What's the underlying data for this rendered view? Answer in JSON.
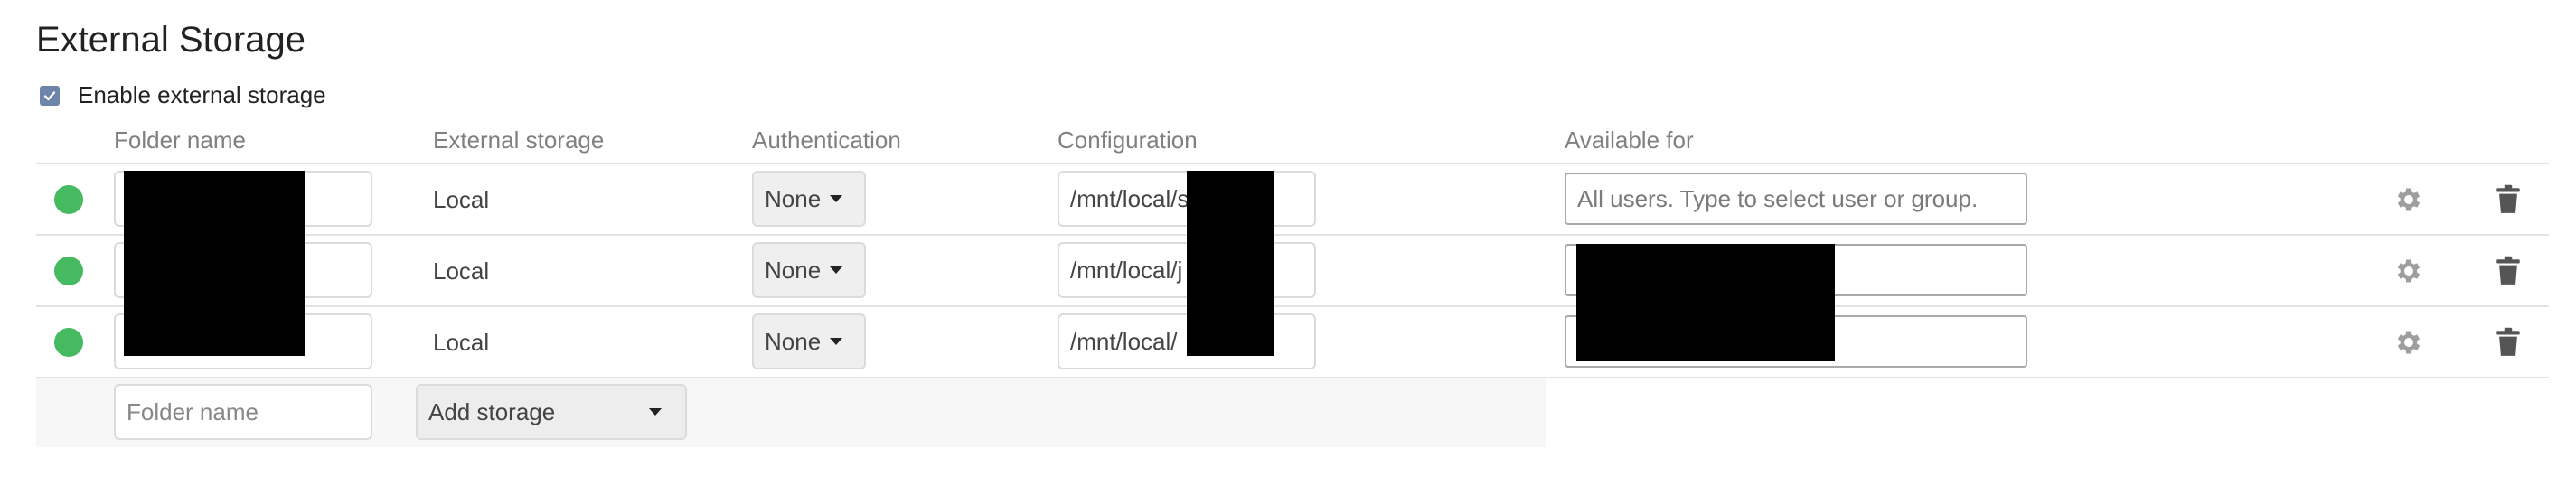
{
  "section": {
    "title": "External Storage",
    "enable_label": "Enable external storage",
    "enable_checked": true
  },
  "headers": {
    "folder_name": "Folder name",
    "external_storage": "External storage",
    "authentication": "Authentication",
    "configuration": "Configuration",
    "available_for": "Available for"
  },
  "mounts": [
    {
      "status": "ok",
      "status_color": "#46ba61",
      "folder_name": "",
      "storage": "Local",
      "authentication": "None",
      "configuration": "/mnt/local/s",
      "available_for": "",
      "available_placeholder": "All users. Type to select user or group."
    },
    {
      "status": "ok",
      "status_color": "#46ba61",
      "folder_name": "",
      "storage": "Local",
      "authentication": "None",
      "configuration": "/mnt/local/j",
      "available_for": "",
      "available_placeholder": ""
    },
    {
      "status": "ok",
      "status_color": "#46ba61",
      "folder_name": "",
      "storage": "Local",
      "authentication": "None",
      "configuration": "/mnt/local/",
      "available_for": "",
      "available_placeholder": ""
    }
  ],
  "add_row": {
    "folder_placeholder": "Folder name",
    "storage_select": "Add storage"
  },
  "icons": {
    "checkbox": "checkmark-icon",
    "status": "status-dot-icon",
    "settings": "gear-icon",
    "delete": "trash-icon",
    "dropdown": "caret-down-icon"
  },
  "colors": {
    "status_ok": "#46ba61",
    "checkbox": "#6e84a8",
    "header_text": "#808080"
  }
}
